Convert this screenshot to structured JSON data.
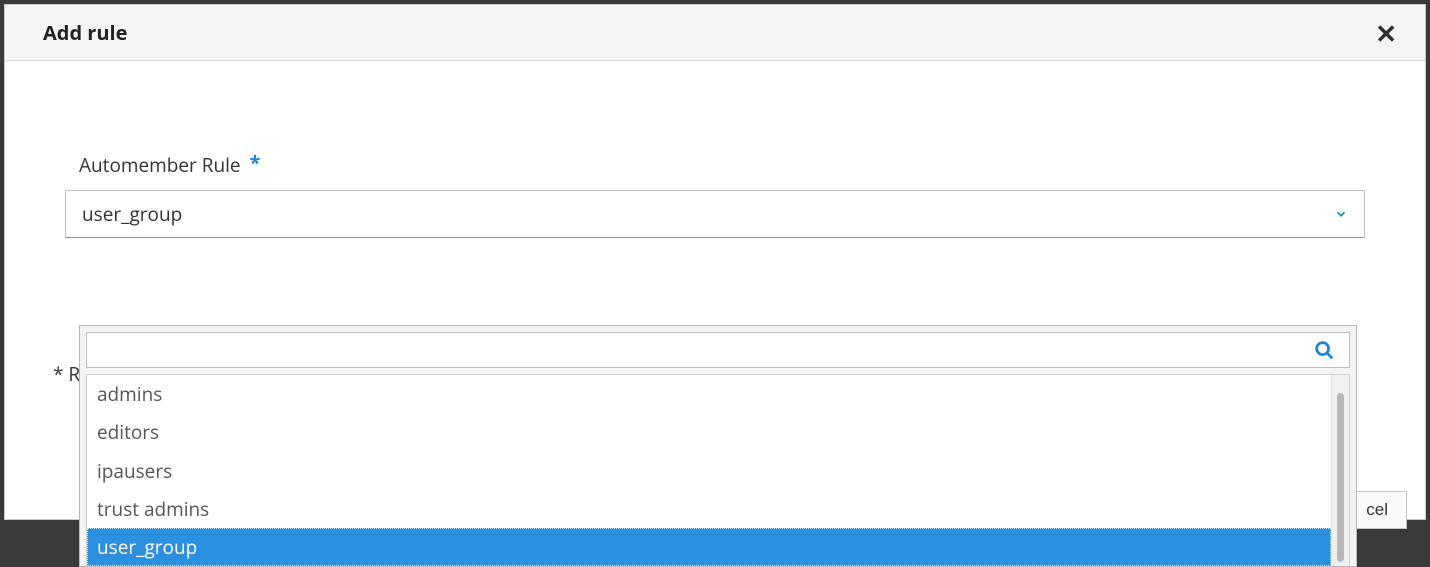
{
  "dialog": {
    "title": "Add rule",
    "field_label": "Automember Rule",
    "selected_value": "user_group",
    "required_note_prefix": "* Re",
    "cancel_label": "cel"
  },
  "dropdown": {
    "search_value": "",
    "options": [
      {
        "label": "admins",
        "selected": false
      },
      {
        "label": "editors",
        "selected": false
      },
      {
        "label": "ipausers",
        "selected": false
      },
      {
        "label": "trust admins",
        "selected": false
      },
      {
        "label": "user_group",
        "selected": true
      }
    ]
  }
}
